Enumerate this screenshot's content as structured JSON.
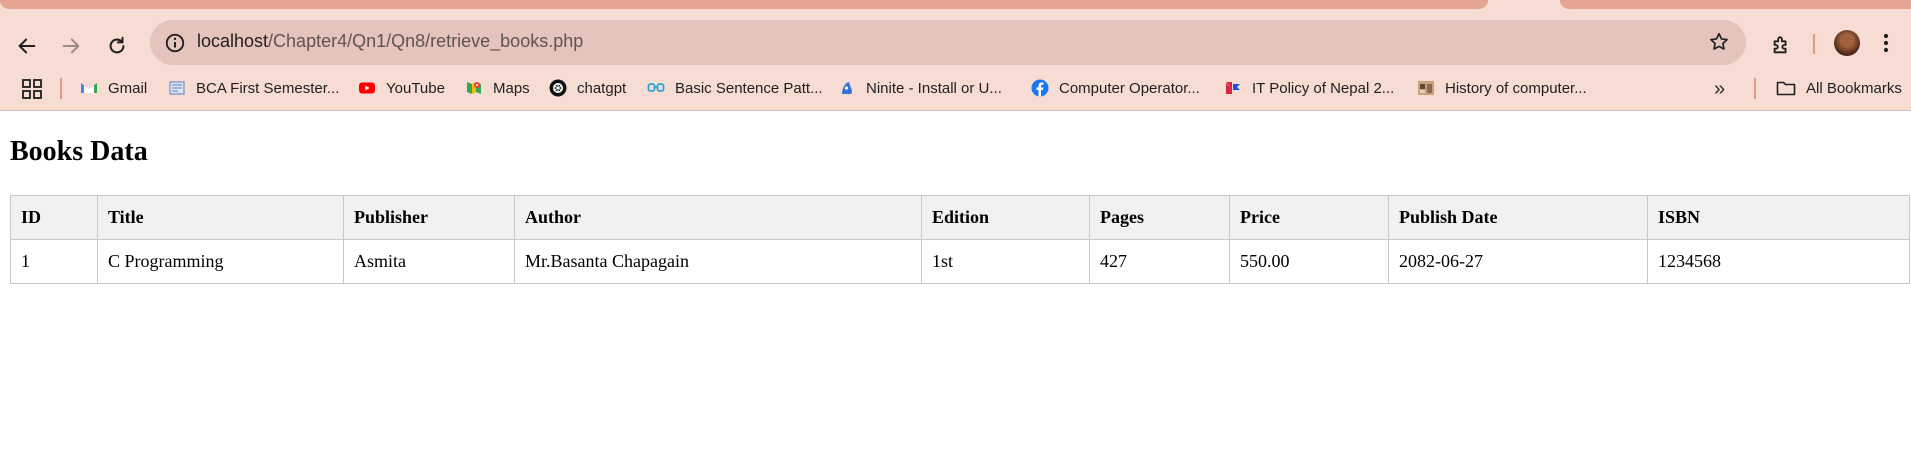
{
  "browser": {
    "url_host": "localhost",
    "url_path": "/Chapter4/Qn1/Qn8/retrieve_books.php",
    "bookmarks": [
      {
        "label": "Gmail",
        "icon": "gmail-icon"
      },
      {
        "label": "BCA First Semester...",
        "icon": "bca-icon"
      },
      {
        "label": "YouTube",
        "icon": "youtube-icon"
      },
      {
        "label": "Maps",
        "icon": "maps-icon"
      },
      {
        "label": "chatgpt",
        "icon": "chatgpt-icon"
      },
      {
        "label": "Basic Sentence Patt...",
        "icon": "glasses-icon"
      },
      {
        "label": "Ninite - Install or U...",
        "icon": "ninite-icon"
      },
      {
        "label": "Computer Operator...",
        "icon": "facebook-icon"
      },
      {
        "label": "IT Policy of Nepal 2...",
        "icon": "it-policy-icon"
      },
      {
        "label": "History of computer...",
        "icon": "history-icon"
      }
    ],
    "all_bookmarks_label": "All Bookmarks",
    "overflow_label": "»"
  },
  "page": {
    "title": "Books Data",
    "table": {
      "headers": [
        "ID",
        "Title",
        "Publisher",
        "Author",
        "Edition",
        "Pages",
        "Price",
        "Publish Date",
        "ISBN"
      ],
      "rows": [
        [
          "1",
          "C Programming",
          "Asmita",
          "Mr.Basanta Chapagain",
          "1st",
          "427",
          "550.00",
          "2082-06-27",
          "1234568"
        ]
      ]
    }
  }
}
